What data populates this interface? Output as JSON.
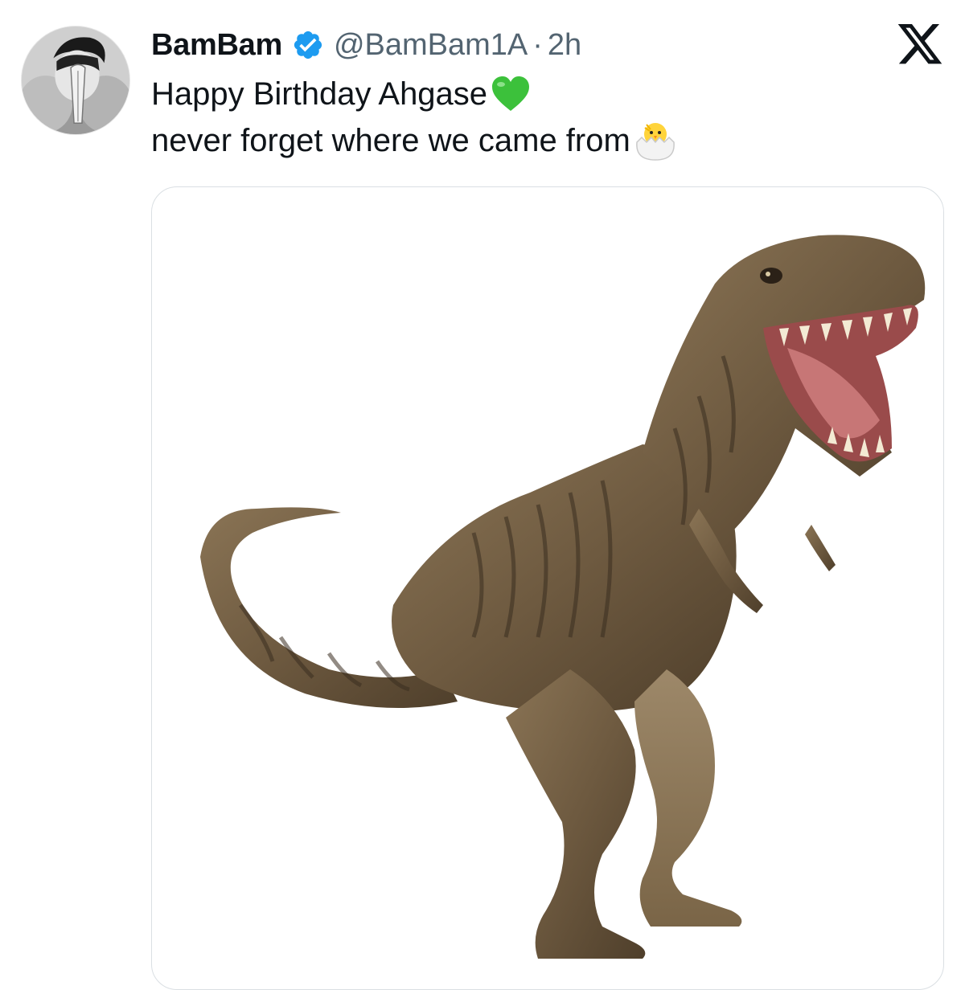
{
  "tweet": {
    "author": {
      "display_name": "BamBam",
      "handle": "@BamBam1A",
      "verified": true,
      "avatar_icon": "profile-photo-praying-hands"
    },
    "separator": "·",
    "time": "2h",
    "text_lines": [
      "Happy Birthday Ahgase",
      "never forget where we came from"
    ],
    "emojis": [
      "green-heart-icon",
      "hatching-chick-icon"
    ],
    "media": {
      "description_icon": "t-rex-dinosaur-image"
    }
  },
  "brand": {
    "logo_icon": "x-logo-icon"
  },
  "colors": {
    "text": "#0f1419",
    "secondary": "#536471",
    "verified": "#1d9bf0",
    "border": "#dadfe3"
  }
}
